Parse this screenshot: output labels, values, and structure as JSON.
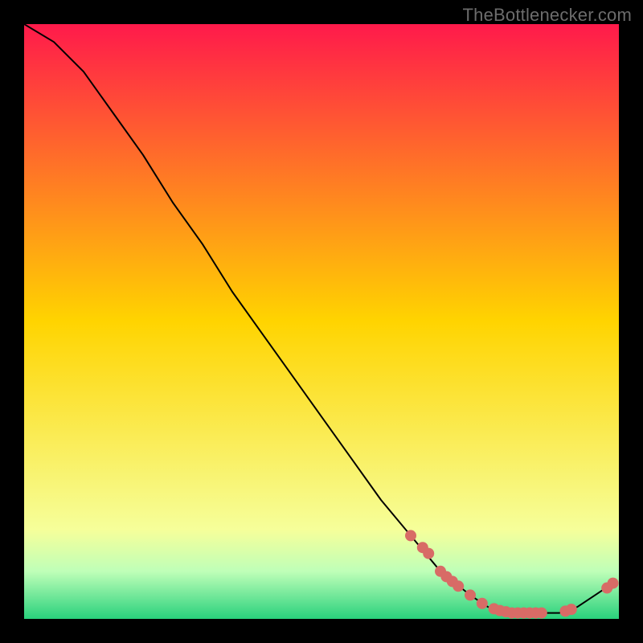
{
  "watermark": "TheBottlenecker.com",
  "chart_data": {
    "type": "line",
    "title": "",
    "xlabel": "",
    "ylabel": "",
    "xlim": [
      0,
      100
    ],
    "ylim": [
      0,
      100
    ],
    "background_gradient": {
      "stops": [
        {
          "pct": 0,
          "color": "#ff1a4b"
        },
        {
          "pct": 50,
          "color": "#ffd400"
        },
        {
          "pct": 85,
          "color": "#f6ff9a"
        },
        {
          "pct": 92,
          "color": "#bfffb8"
        },
        {
          "pct": 100,
          "color": "#29d17c"
        }
      ]
    },
    "curve": [
      {
        "x": 0,
        "y": 100
      },
      {
        "x": 5,
        "y": 97
      },
      {
        "x": 10,
        "y": 92
      },
      {
        "x": 15,
        "y": 85
      },
      {
        "x": 20,
        "y": 78
      },
      {
        "x": 25,
        "y": 70
      },
      {
        "x": 30,
        "y": 63
      },
      {
        "x": 35,
        "y": 55
      },
      {
        "x": 40,
        "y": 48
      },
      {
        "x": 45,
        "y": 41
      },
      {
        "x": 50,
        "y": 34
      },
      {
        "x": 55,
        "y": 27
      },
      {
        "x": 60,
        "y": 20
      },
      {
        "x": 65,
        "y": 14
      },
      {
        "x": 70,
        "y": 8
      },
      {
        "x": 75,
        "y": 4
      },
      {
        "x": 78,
        "y": 2
      },
      {
        "x": 82,
        "y": 1
      },
      {
        "x": 86,
        "y": 1
      },
      {
        "x": 90,
        "y": 1
      },
      {
        "x": 93,
        "y": 2
      },
      {
        "x": 96,
        "y": 4
      },
      {
        "x": 99,
        "y": 6
      }
    ],
    "markers": [
      {
        "x": 65,
        "y": 14
      },
      {
        "x": 67,
        "y": 12.0
      },
      {
        "x": 68,
        "y": 11.0
      },
      {
        "x": 70,
        "y": 8.0
      },
      {
        "x": 71,
        "y": 7.1
      },
      {
        "x": 72,
        "y": 6.3
      },
      {
        "x": 73,
        "y": 5.5
      },
      {
        "x": 75,
        "y": 4.0
      },
      {
        "x": 77,
        "y": 2.6
      },
      {
        "x": 79,
        "y": 1.7
      },
      {
        "x": 80,
        "y": 1.4
      },
      {
        "x": 81,
        "y": 1.2
      },
      {
        "x": 82,
        "y": 1.0
      },
      {
        "x": 83,
        "y": 1.0
      },
      {
        "x": 84,
        "y": 1.0
      },
      {
        "x": 85,
        "y": 1.0
      },
      {
        "x": 86,
        "y": 1.0
      },
      {
        "x": 87,
        "y": 1.0
      },
      {
        "x": 91,
        "y": 1.3
      },
      {
        "x": 92,
        "y": 1.6
      },
      {
        "x": 98,
        "y": 5.2
      },
      {
        "x": 99,
        "y": 6.0
      }
    ],
    "marker_style": {
      "radius": 7,
      "fill": "#d86b66",
      "stroke": "#000000",
      "stroke_width": 0
    },
    "curve_style": {
      "stroke": "#000000",
      "stroke_width": 2
    }
  }
}
